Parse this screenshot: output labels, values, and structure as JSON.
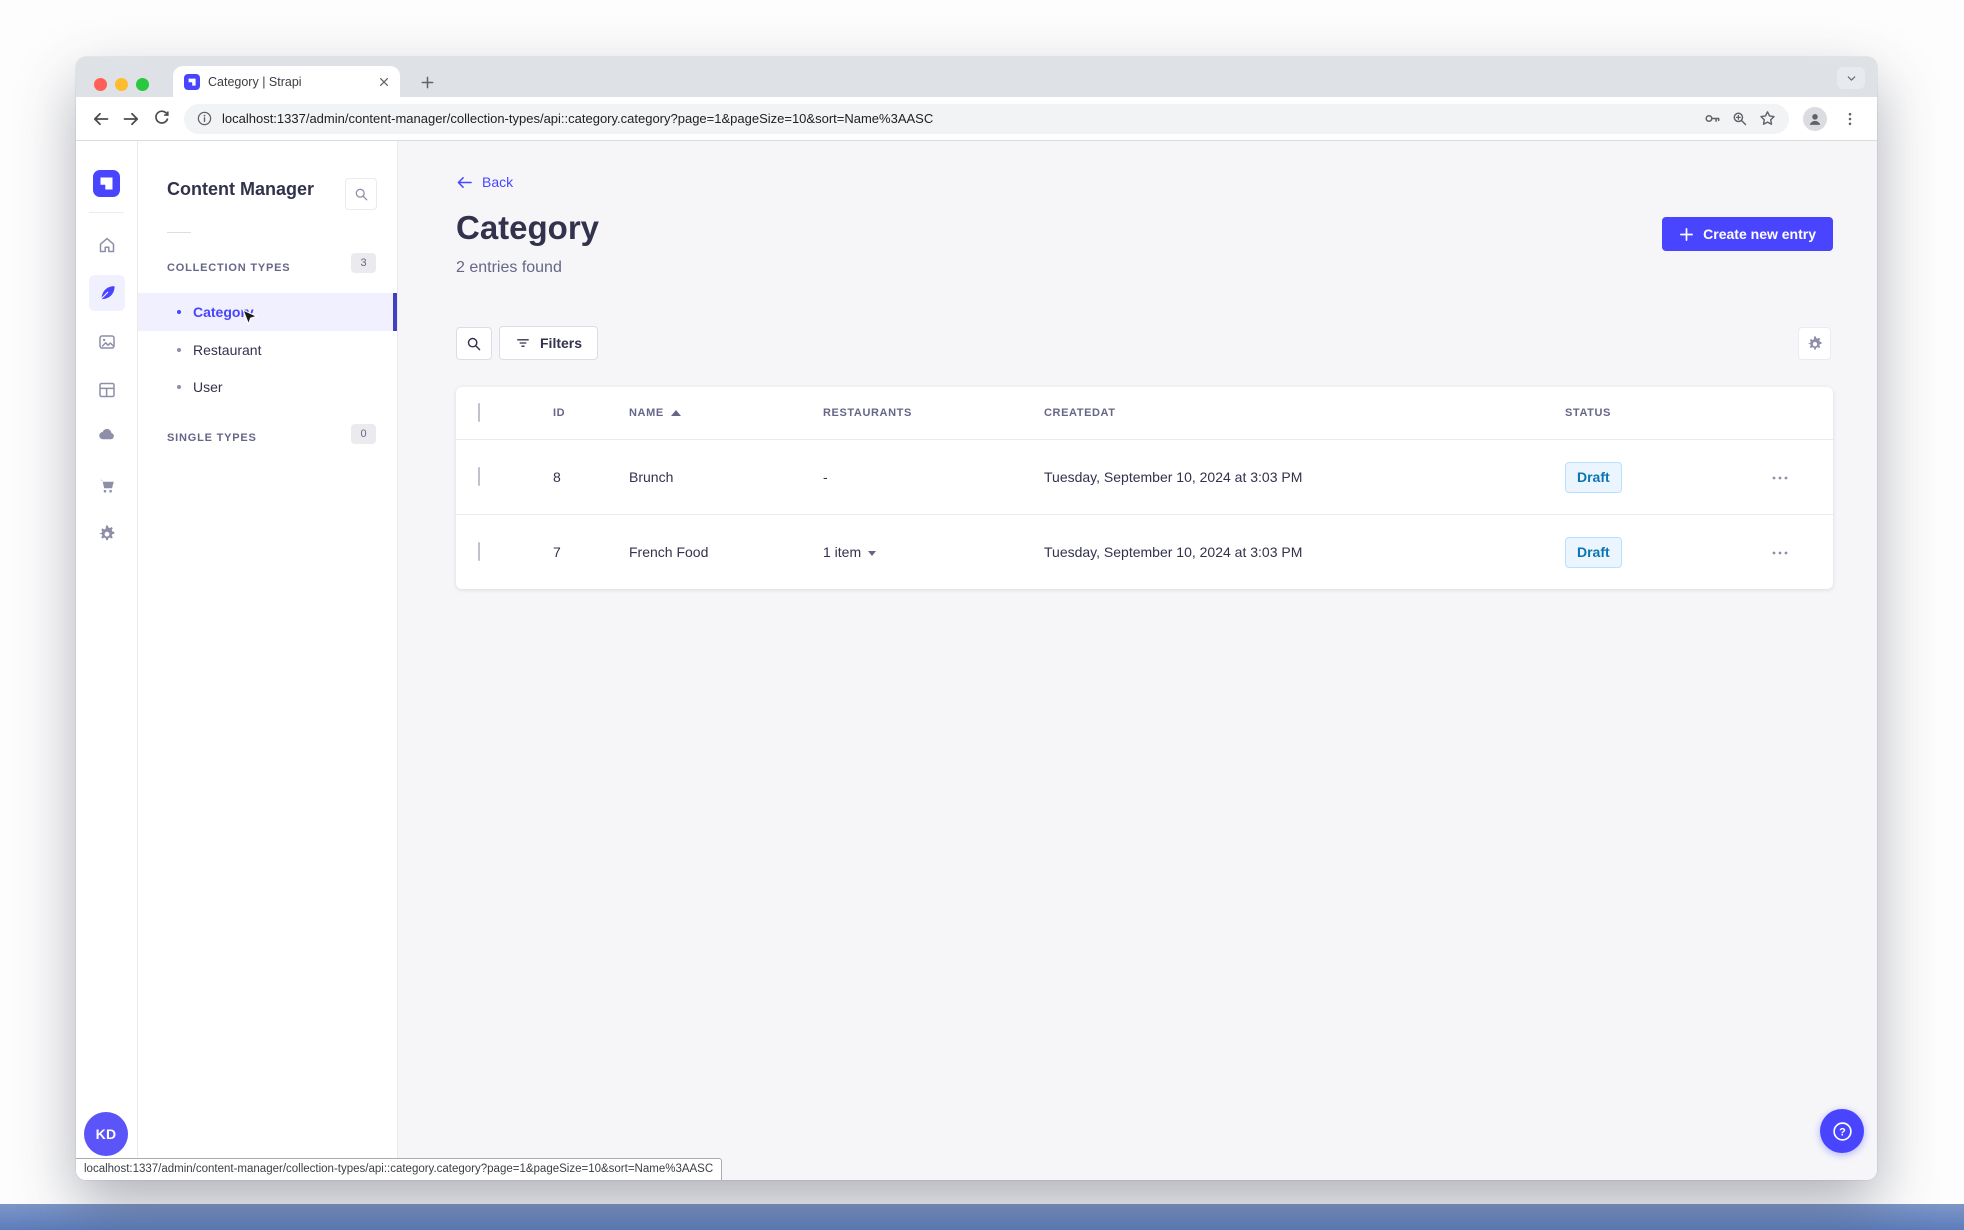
{
  "browser": {
    "tab_title": "Category | Strapi",
    "url": "localhost:1337/admin/content-manager/collection-types/api::category.category?page=1&pageSize=10&sort=Name%3AASC",
    "status_url": "localhost:1337/admin/content-manager/collection-types/api::category.category?page=1&pageSize=10&sort=Name%3AASC"
  },
  "rail": {
    "icons": [
      "strapi-logo",
      "home",
      "content-manager-feather",
      "media-library",
      "content-type-builder-layout",
      "cloud",
      "marketplace-cart",
      "settings-gear"
    ],
    "avatar_initials": "KD"
  },
  "sidebar": {
    "title": "Content Manager",
    "collection_section": {
      "label": "Collection Types",
      "count": "3",
      "items": [
        {
          "label": "Category",
          "active": true
        },
        {
          "label": "Restaurant",
          "active": false
        },
        {
          "label": "User",
          "active": false
        }
      ]
    },
    "single_section": {
      "label": "Single Types",
      "count": "0"
    }
  },
  "header": {
    "back_label": "Back",
    "title": "Category",
    "subtitle": "2 entries found",
    "create_label": "Create new entry"
  },
  "actionbar": {
    "filters_label": "Filters"
  },
  "table": {
    "headers": [
      "ID",
      "NAME",
      "RESTAURANTS",
      "CREATEDAT",
      "STATUS"
    ],
    "rows": [
      {
        "id": "8",
        "name": "Brunch",
        "restaurants": "-",
        "created": "Tuesday, September 10, 2024 at 3:03 PM",
        "status": "Draft"
      },
      {
        "id": "7",
        "name": "French Food",
        "restaurants": "1 item",
        "created": "Tuesday, September 10, 2024 at 3:03 PM",
        "status": "Draft"
      }
    ]
  },
  "colors": {
    "primary": "#4945ff",
    "active_bg": "#f0f0ff",
    "draft_text": "#0c75af",
    "draft_bg": "#eaf5ff"
  }
}
